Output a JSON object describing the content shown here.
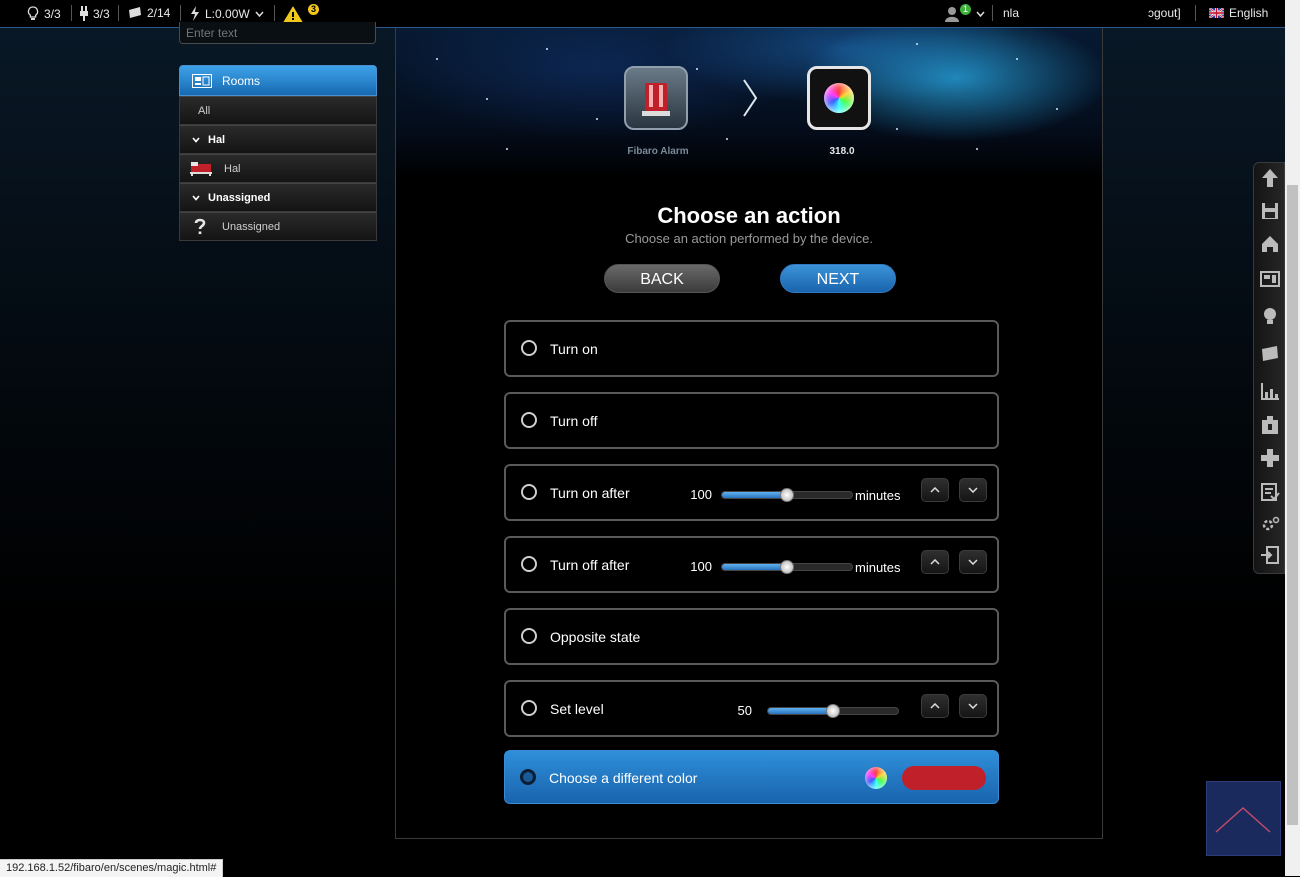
{
  "topbar": {
    "lights": "3/3",
    "plugs": "3/3",
    "blinds": "2/14",
    "power": "L:0.00W",
    "alerts_count": "3",
    "user_badge": "1",
    "user_name": "nla",
    "logout": "ɔgout]",
    "language": "English"
  },
  "search": {
    "placeholder": "Enter text"
  },
  "rooms": {
    "header": "Rooms",
    "items": [
      {
        "label": "All",
        "type": "all"
      },
      {
        "label": "Hal",
        "type": "group"
      },
      {
        "label": "Hal",
        "type": "room"
      },
      {
        "label": "Unassigned",
        "type": "group"
      },
      {
        "label": "Unassigned",
        "type": "room"
      }
    ]
  },
  "wizard": {
    "source_device": "Fibaro Alarm",
    "target_device": "318.0",
    "title": "Choose an action",
    "subtitle": "Choose an action performed by the device.",
    "back": "BACK",
    "next": "NEXT"
  },
  "actions": {
    "turn_on": "Turn on",
    "turn_off": "Turn off",
    "turn_on_after": {
      "label": "Turn on after",
      "value": "100",
      "unit": "minutes",
      "slider_fraction": 0.5
    },
    "turn_off_after": {
      "label": "Turn off after",
      "value": "100",
      "unit": "minutes",
      "slider_fraction": 0.5
    },
    "opposite_state": "Opposite state",
    "set_level": {
      "label": "Set level",
      "value": "50",
      "slider_fraction": 0.5
    },
    "choose_color": {
      "label": "Choose a different color",
      "selected_color": "#c0202a",
      "selected": true
    }
  },
  "colors": {
    "accent": "#1f72bd",
    "warning": "#f2c81c"
  },
  "status_url": "192.168.1.52/fibaro/en/scenes/magic.html#"
}
